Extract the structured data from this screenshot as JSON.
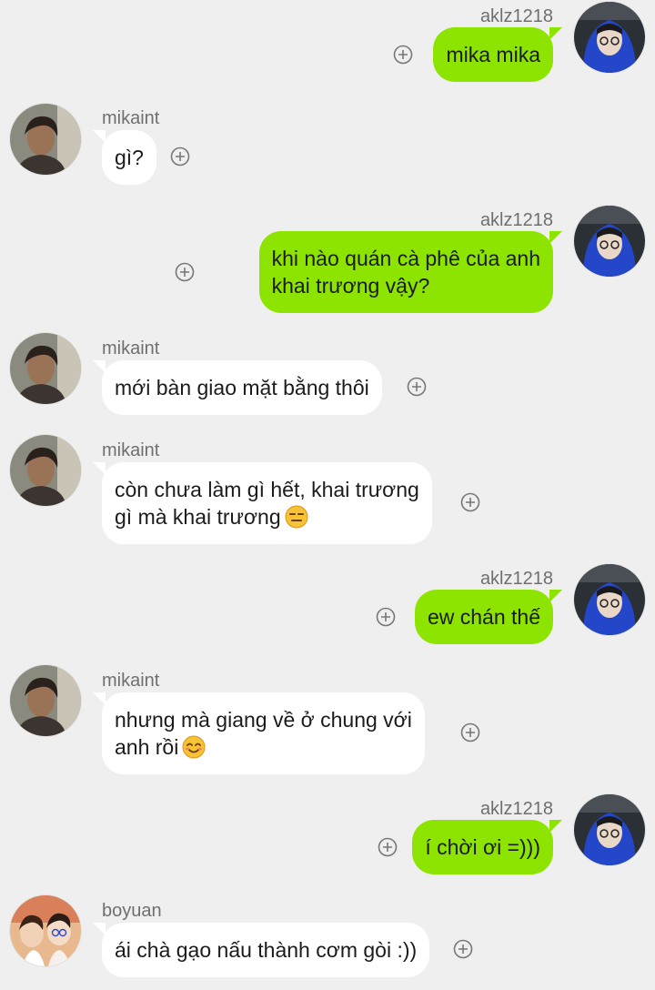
{
  "messages": [
    {
      "id": 1,
      "side": "mine",
      "sender": "aklz1218",
      "lines": [
        "mika mika"
      ],
      "emoji": null
    },
    {
      "id": 2,
      "side": "theirs",
      "sender": "mikaint",
      "lines": [
        "gì?"
      ],
      "emoji": null
    },
    {
      "id": 3,
      "side": "mine",
      "sender": "aklz1218",
      "lines": [
        "khi nào quán cà phê của anh",
        "khai trương vậy?"
      ],
      "emoji": null
    },
    {
      "id": 4,
      "side": "theirs",
      "sender": "mikaint",
      "lines": [
        "mới bàn giao mặt bằng thôi"
      ],
      "emoji": null
    },
    {
      "id": 5,
      "side": "theirs",
      "sender": "mikaint",
      "lines": [
        "còn chưa làm gì hết, khai trương",
        "gì mà khai trương"
      ],
      "emoji": "expressionless-face-icon"
    },
    {
      "id": 6,
      "side": "mine",
      "sender": "aklz1218",
      "lines": [
        "ew chán thế"
      ],
      "emoji": null
    },
    {
      "id": 7,
      "side": "theirs",
      "sender": "mikaint",
      "lines": [
        "nhưng mà giang về ở chung với",
        "anh rồi"
      ],
      "emoji": "smiling-face-icon"
    },
    {
      "id": 8,
      "side": "mine",
      "sender": "aklz1218",
      "lines": [
        "í chời ơi =)))"
      ],
      "emoji": null
    },
    {
      "id": 9,
      "side": "theirs",
      "sender": "boyuan",
      "lines": [
        "ái chà gạo nấu thành cơm gòi :))"
      ],
      "emoji": null
    }
  ],
  "colors": {
    "mine_bubble": "#8de400",
    "theirs_bubble": "#ffffff",
    "background": "#efefef",
    "sender_text": "#6f6f6f"
  },
  "icons": {
    "add_reaction": "plus-circle-icon"
  }
}
